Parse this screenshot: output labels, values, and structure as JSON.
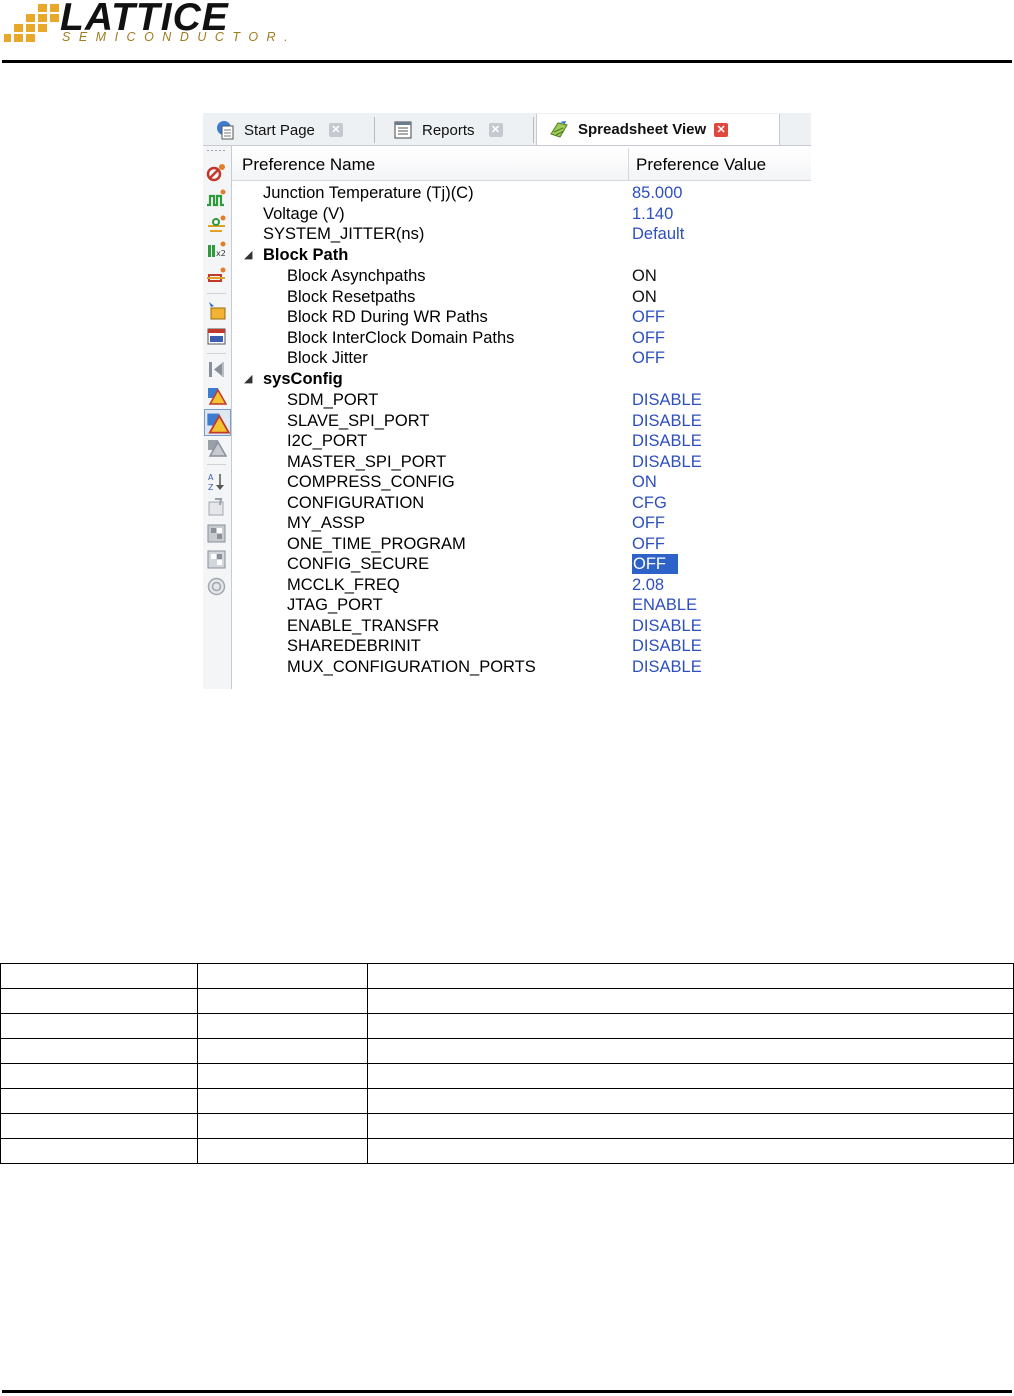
{
  "header": {
    "logo_word": "LATTICE",
    "logo_sub": "SEMICONDUCTOR."
  },
  "tabs": [
    {
      "label": "Start Page",
      "icon": "start-page-icon",
      "active": false
    },
    {
      "label": "Reports",
      "icon": "reports-icon",
      "active": false
    },
    {
      "label": "Spreadsheet View",
      "icon": "spreadsheet-view-icon",
      "active": true
    }
  ],
  "toolbar_icons": [
    "port-assignments-icon",
    "timing-preferences-icon",
    "clock-route-icon",
    "group-icon",
    "route-priority-icon",
    "cell-mapping-icon",
    "global-preferences-icon",
    "back-annotate-icon",
    "show-warnings-icon",
    "show-errors-icon",
    "show-info-icon",
    "sort-icon",
    "refresh-icon",
    "export-icon",
    "import-icon",
    "help-icon"
  ],
  "grid": {
    "col_name": "Preference Name",
    "col_value": "Preference Value",
    "rows": [
      {
        "name": "Junction Temperature (Tj)(C)",
        "value": "85.000",
        "level": 1,
        "value_color": "blue"
      },
      {
        "name": "Voltage (V)",
        "value": "1.140",
        "level": 1,
        "value_color": "blue"
      },
      {
        "name": "SYSTEM_JITTER(ns)",
        "value": "Default",
        "level": 1,
        "value_color": "blue"
      },
      {
        "name": "Block Path",
        "value": "",
        "level": 0,
        "group": true
      },
      {
        "name": "Block Asynchpaths",
        "value": "ON",
        "level": 2,
        "value_color": "black"
      },
      {
        "name": "Block Resetpaths",
        "value": "ON",
        "level": 2,
        "value_color": "black"
      },
      {
        "name": "Block RD During WR Paths",
        "value": "OFF",
        "level": 2,
        "value_color": "blue"
      },
      {
        "name": "Block InterClock Domain Paths",
        "value": "OFF",
        "level": 2,
        "value_color": "blue"
      },
      {
        "name": "Block Jitter",
        "value": "OFF",
        "level": 2,
        "value_color": "blue"
      },
      {
        "name": "sysConfig",
        "value": "",
        "level": 0,
        "group": true
      },
      {
        "name": "SDM_PORT",
        "value": "DISABLE",
        "level": 2,
        "value_color": "blue"
      },
      {
        "name": "SLAVE_SPI_PORT",
        "value": "DISABLE",
        "level": 2,
        "value_color": "blue"
      },
      {
        "name": "I2C_PORT",
        "value": "DISABLE",
        "level": 2,
        "value_color": "blue"
      },
      {
        "name": "MASTER_SPI_PORT",
        "value": "DISABLE",
        "level": 2,
        "value_color": "blue"
      },
      {
        "name": "COMPRESS_CONFIG",
        "value": "ON",
        "level": 2,
        "value_color": "blue"
      },
      {
        "name": "CONFIGURATION",
        "value": "CFG",
        "level": 2,
        "value_color": "blue"
      },
      {
        "name": "MY_ASSP",
        "value": "OFF",
        "level": 2,
        "value_color": "blue"
      },
      {
        "name": "ONE_TIME_PROGRAM",
        "value": "OFF",
        "level": 2,
        "value_color": "blue"
      },
      {
        "name": "CONFIG_SECURE",
        "value": "OFF",
        "level": 2,
        "value_color": "selected"
      },
      {
        "name": "MCCLK_FREQ",
        "value": "2.08",
        "level": 2,
        "value_color": "blue"
      },
      {
        "name": "JTAG_PORT",
        "value": "ENABLE",
        "level": 2,
        "value_color": "blue"
      },
      {
        "name": "ENABLE_TRANSFR",
        "value": "DISABLE",
        "level": 2,
        "value_color": "blue"
      },
      {
        "name": "SHAREDEBRINIT",
        "value": "DISABLE",
        "level": 2,
        "value_color": "blue"
      },
      {
        "name": "MUX_CONFIGURATION_PORTS",
        "value": "DISABLE",
        "level": 2,
        "value_color": "blue"
      }
    ]
  },
  "doc_table": {
    "rows": 8,
    "cols": 3
  }
}
